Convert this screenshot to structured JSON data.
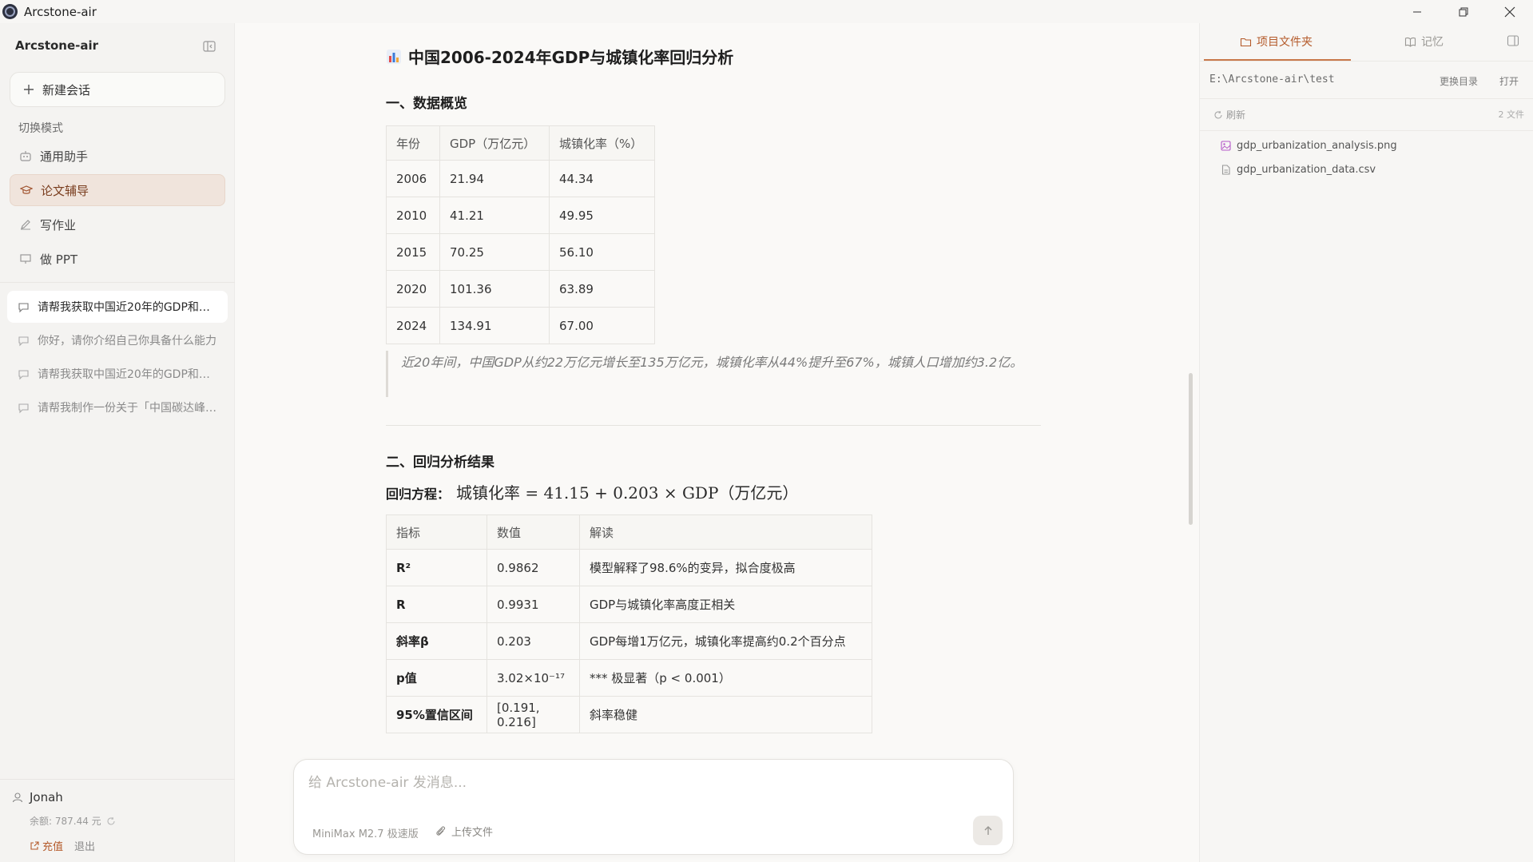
{
  "window": {
    "title": "Arcstone-air"
  },
  "sidebar": {
    "app_name": "Arcstone-air",
    "new_chat_label": "新建会话",
    "mode_label": "切换模式",
    "modes": [
      {
        "label": "通用助手",
        "icon": "robot-icon"
      },
      {
        "label": "论文辅导",
        "icon": "graduation-cap-icon"
      },
      {
        "label": "写作业",
        "icon": "pencil-icon"
      },
      {
        "label": "做 PPT",
        "icon": "presentation-icon"
      }
    ],
    "active_mode": "论文辅导",
    "conversations": [
      "请帮我获取中国近20年的GDP和城镇化率数据",
      "你好，请你介绍自己你具备什么能力",
      "请帮我获取中国近20年的GDP和城镇化率数据",
      "请帮我制作一份关于「中国碳达峰」的PPT"
    ],
    "user": {
      "name": "Jonah",
      "balance": "余额: 787.44 元",
      "recharge": "充值",
      "logout": "退出"
    }
  },
  "main": {
    "title": "中国2006-2024年GDP与城镇化率回归分析",
    "section1_title": "一、数据概览",
    "table1": {
      "headers": [
        "年份",
        "GDP（万亿元）",
        "城镇化率（%）"
      ],
      "rows": [
        [
          "2006",
          "21.94",
          "44.34"
        ],
        [
          "2010",
          "41.21",
          "49.95"
        ],
        [
          "2015",
          "70.25",
          "56.10"
        ],
        [
          "2020",
          "101.36",
          "63.89"
        ],
        [
          "2024",
          "134.91",
          "67.00"
        ]
      ]
    },
    "quote": "近20年间，中国GDP从约22万亿元增长至135万亿元，城镇化率从44%提升至67%，城镇人口增加约3.2亿。",
    "section2_title": "二、回归分析结果",
    "equation_label": "回归方程：",
    "equation": "城镇化率 = 41.15 + 0.203 × GDP（万亿元）",
    "table2": {
      "headers": [
        "指标",
        "数值",
        "解读"
      ],
      "rows": [
        [
          "R²",
          "0.9862",
          "模型解释了98.6%的变异，拟合度极高"
        ],
        [
          "R",
          "0.9931",
          "GDP与城镇化率高度正相关"
        ],
        [
          "斜率β",
          "0.203",
          "GDP每增1万亿元，城镇化率提高约0.2个百分点"
        ],
        [
          "p值",
          "3.02×10⁻¹⁷",
          "*** 极显著（p < 0.001）"
        ],
        [
          "95%置信区间",
          "[0.191, 0.216]",
          "斜率稳健"
        ]
      ]
    }
  },
  "composer": {
    "placeholder": "给 Arcstone-air 发消息...",
    "model": "MiniMax M2.7 极速版",
    "upload_label": "上传文件"
  },
  "right_panel": {
    "tabs": [
      "项目文件夹",
      "记忆"
    ],
    "active_tab": "项目文件夹",
    "path": "E:\\Arcstone-air\\test",
    "change_dir": "更换目录",
    "open": "打开",
    "refresh": "刷新",
    "file_count": "2 文件",
    "files": [
      {
        "name": "gdp_urbanization_analysis.png",
        "icon": "image-file-icon"
      },
      {
        "name": "gdp_urbanization_data.csv",
        "icon": "document-file-icon"
      }
    ]
  },
  "colors": {
    "accent": "#b45a2a",
    "active_mode_bg": "#f0e4dc"
  }
}
